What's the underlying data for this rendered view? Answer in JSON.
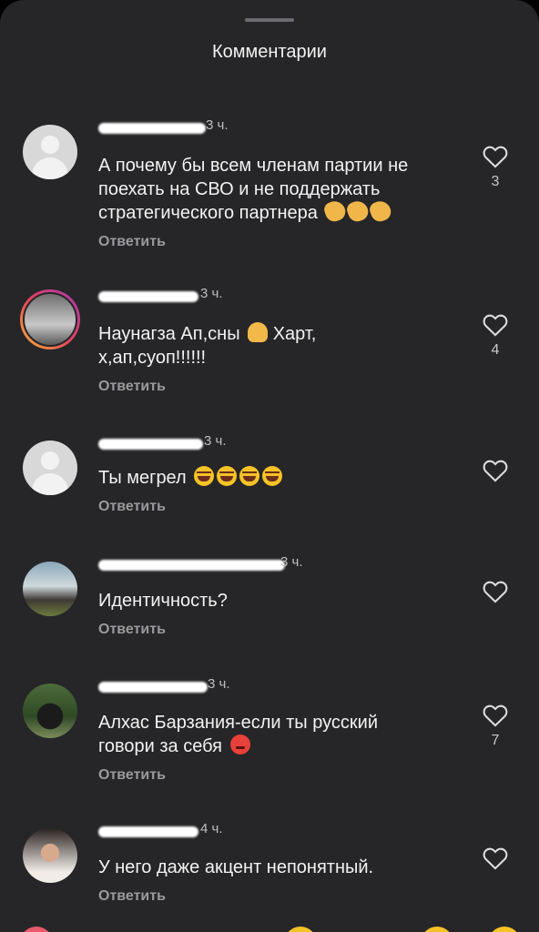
{
  "header": {
    "title": "Комментарии"
  },
  "comments": [
    {
      "time": "3 ч.",
      "text": "А почему бы всем членам партии не поехать на СВО и не поддержать стратегического партнера",
      "reply": "Ответить",
      "likes": "3"
    },
    {
      "time": "3 ч.",
      "text": "Наунагза Ап,сны",
      "text2": "Харт, х,ап,суоп!!!!!!",
      "reply": "Ответить",
      "likes": "4"
    },
    {
      "time": "3 ч.",
      "text": "Ты мегрел",
      "reply": "Ответить",
      "likes": ""
    },
    {
      "time": "3 ч.",
      "text": "Идентичность?",
      "reply": "Ответить",
      "likes": ""
    },
    {
      "time": "3 ч.",
      "text": "Алхас Барзания-если ты русский говори за себя",
      "reply": "Ответить",
      "likes": "7"
    },
    {
      "time": "4 ч.",
      "text": "У него даже акцент непонятный.",
      "reply": "Ответить",
      "likes": ""
    }
  ],
  "icons": {
    "like": "heart-outline-icon",
    "redacted": "username-redacted"
  },
  "colors": {
    "background": "#262628",
    "text": "#f2f2f2",
    "muted": "#9a9a9e"
  }
}
